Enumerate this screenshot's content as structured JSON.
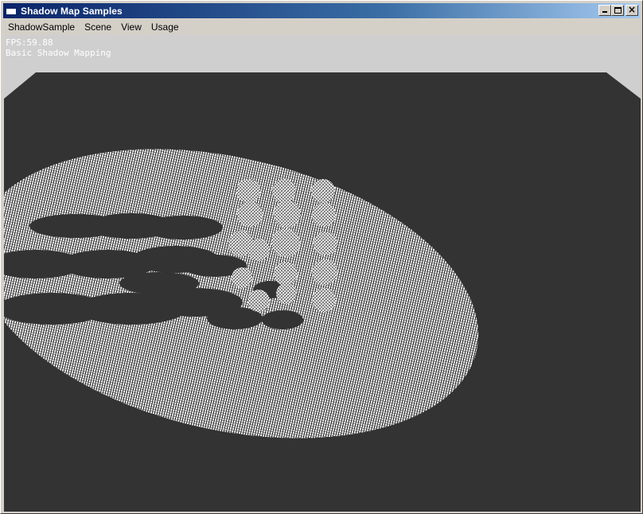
{
  "window": {
    "title": "Shadow Map Samples",
    "controls": {
      "minimize": "minimize-icon",
      "maximize": "maximize-icon",
      "close": "close-icon"
    }
  },
  "menu": {
    "items": [
      {
        "label": "ShadowSample"
      },
      {
        "label": "Scene"
      },
      {
        "label": "View"
      },
      {
        "label": "Usage"
      }
    ]
  },
  "viewport": {
    "fps": "FPS:59.88",
    "sample_name": "Basic Shadow Mapping",
    "colors": {
      "background": "#cfcfcf",
      "floor": "#333333",
      "disc": "#ffffff"
    }
  }
}
